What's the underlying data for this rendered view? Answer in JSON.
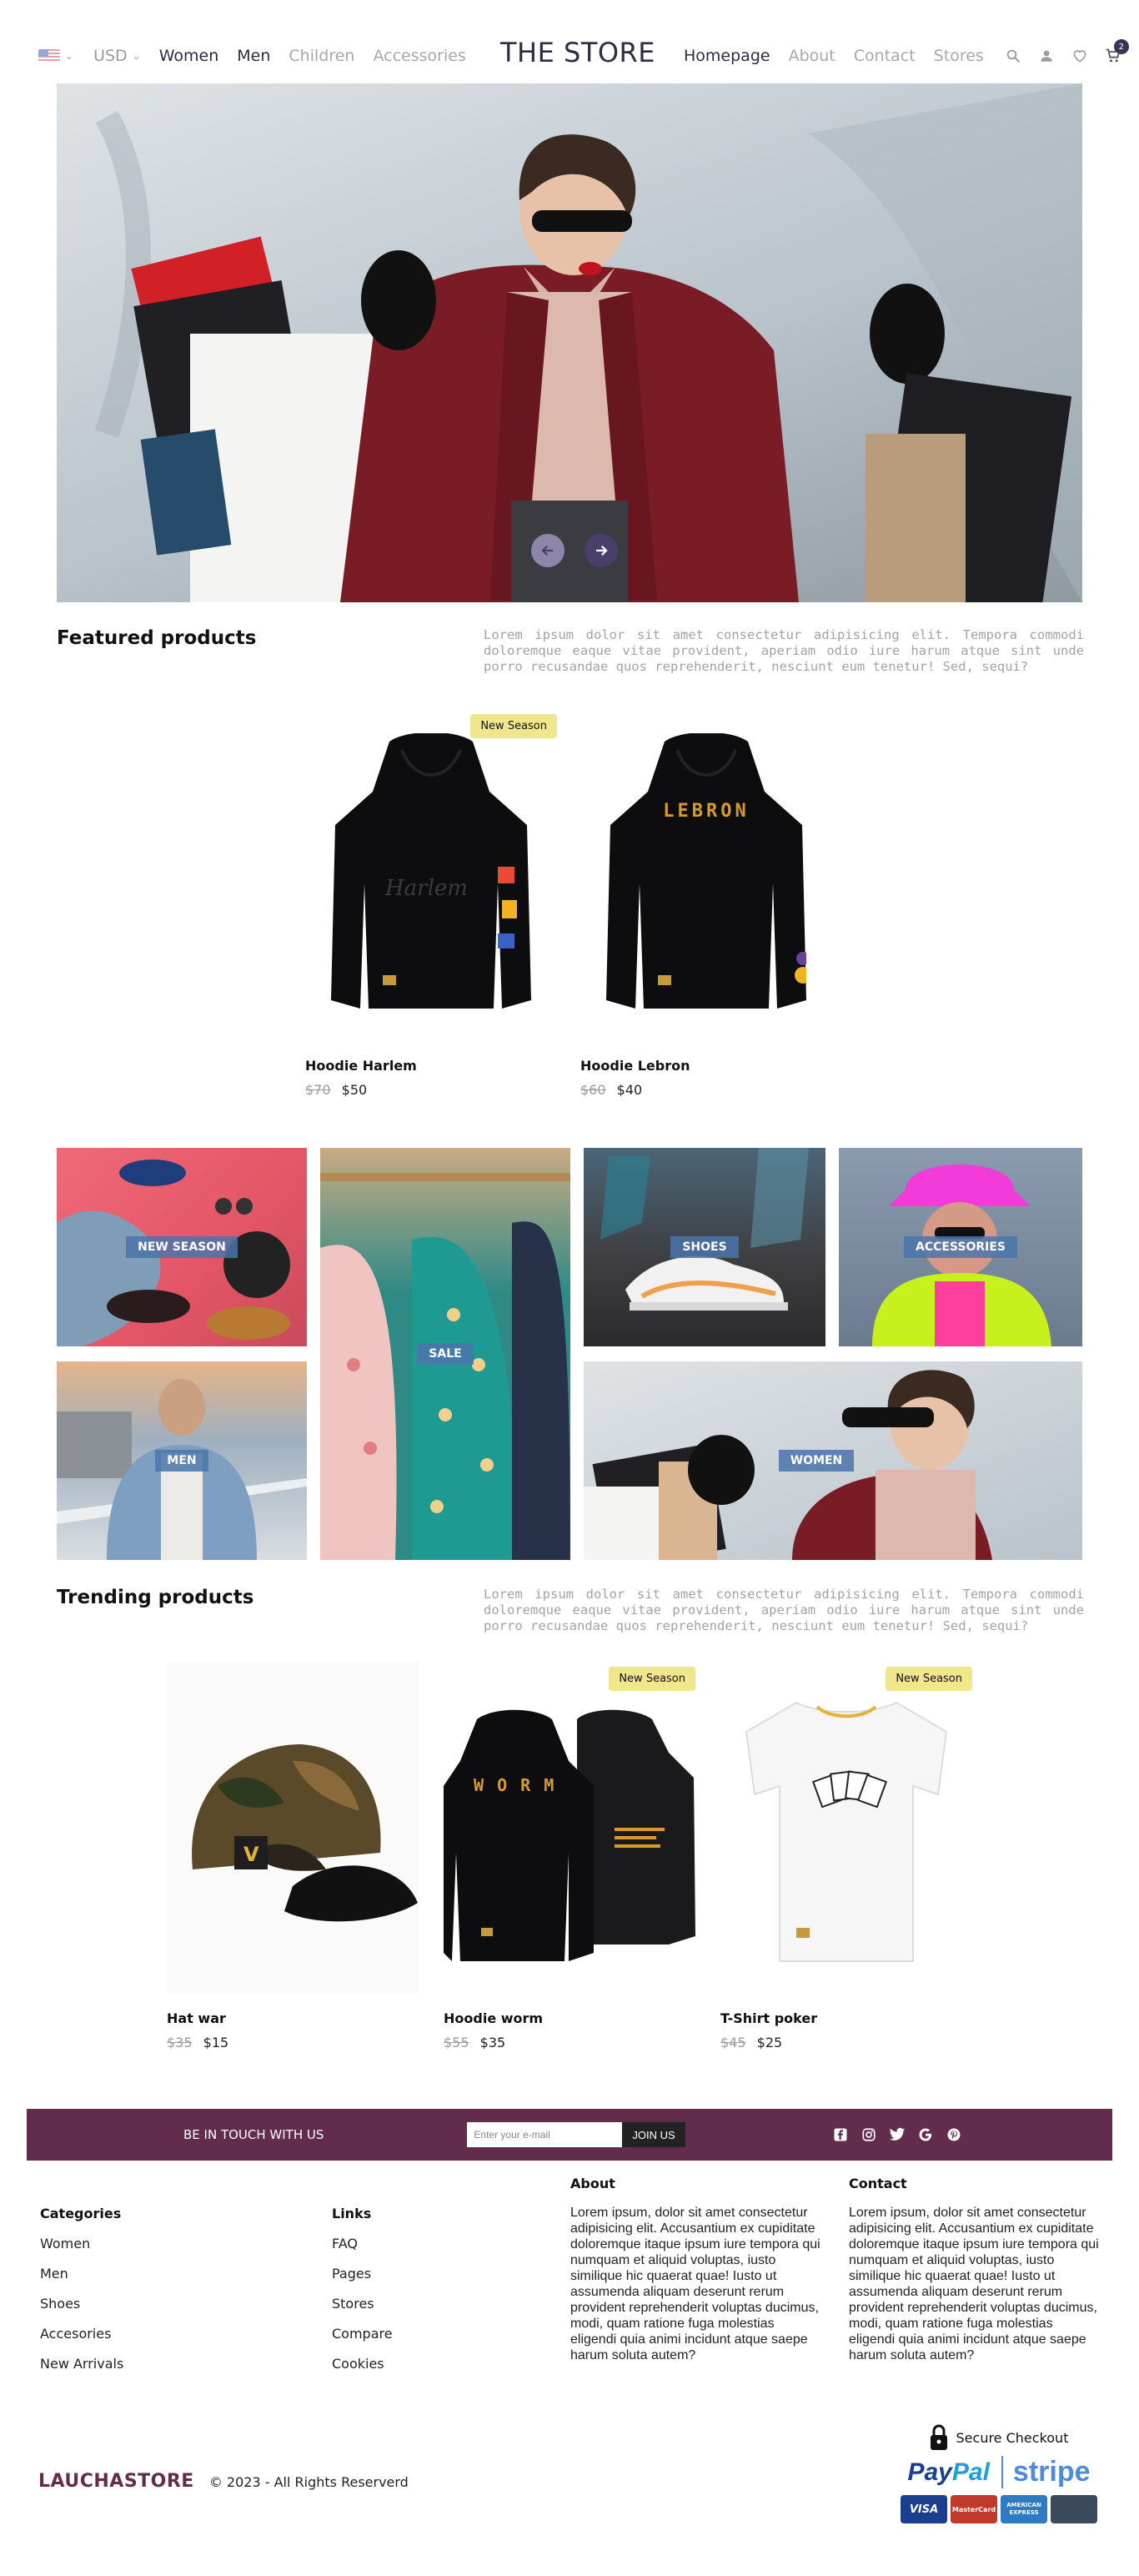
{
  "header": {
    "currency": "USD",
    "left_links": [
      "Women",
      "Men",
      "Children",
      "Accessories"
    ],
    "brand": "THE STORE",
    "right_links": [
      "Homepage",
      "About",
      "Contact",
      "Stores"
    ],
    "cart_count": "2"
  },
  "featured": {
    "title": "Featured products",
    "description": "Lorem ipsum dolor sit amet consectetur adipisicing elit. Tempora commodi doloremque eaque vitae provident, aperiam odio iure harum atque sint unde porro recusandae quos reprehenderit, nesciunt eum tenetur! Sed, sequi?",
    "products": [
      {
        "name": "Hoodie Harlem",
        "old_price": "$70",
        "price": "$50",
        "badge": "New Season",
        "print": "Harlem"
      },
      {
        "name": "Hoodie Lebron",
        "old_price": "$60",
        "price": "$40",
        "badge": "",
        "print": "LEBRON"
      }
    ]
  },
  "categories": {
    "new_season": "NEW SEASON",
    "sale": "SALE",
    "shoes": "SHOES",
    "accessories": "ACCESSORIES",
    "men": "MEN",
    "women": "WOMEN"
  },
  "trending": {
    "title": "Trending products",
    "description": "Lorem ipsum dolor sit amet consectetur adipisicing elit. Tempora commodi doloremque eaque vitae provident, aperiam odio iure harum atque sint unde porro recusandae quos reprehenderit, nesciunt eum tenetur! Sed, sequi?",
    "products": [
      {
        "name": "Hat war",
        "old_price": "$35",
        "price": "$15",
        "badge": ""
      },
      {
        "name": "Hoodie worm",
        "old_price": "$55",
        "price": "$35",
        "badge": "New Season",
        "print": "W O R M"
      },
      {
        "name": "T-Shirt poker",
        "old_price": "$45",
        "price": "$25",
        "badge": "New Season"
      }
    ]
  },
  "newsletter": {
    "title": "BE IN TOUCH WITH US",
    "placeholder": "Enter your e-mail",
    "button": "JOIN US"
  },
  "footer": {
    "categories_title": "Categories",
    "categories": [
      "Women",
      "Men",
      "Shoes",
      "Accesories",
      "New Arrivals"
    ],
    "links_title": "Links",
    "links": [
      "FAQ",
      "Pages",
      "Stores",
      "Compare",
      "Cookies"
    ],
    "about_title": "About",
    "about_text": "Lorem ipsum, dolor sit amet consectetur adipisicing elit. Accusantium ex cupiditate doloremque itaque ipsum iure tempora qui numquam et aliquid voluptas, iusto similique hic quaerat quae! Iusto ut assumenda aliquam deserunt rerum provident reprehenderit voluptas ducimus, modi, quam ratione fuga molestias eligendi quia animi incidunt atque saepe harum soluta autem?",
    "contact_title": "Contact",
    "contact_text": "Lorem ipsum, dolor sit amet consectetur adipisicing elit. Accusantium ex cupiditate doloremque itaque ipsum iure tempora qui numquam et aliquid voluptas, iusto similique hic quaerat quae! Iusto ut assumenda aliquam deserunt rerum provident reprehenderit voluptas ducimus, modi, quam ratione fuga molestias eligendi quia animi incidunt atque saepe harum soluta autem?",
    "brand": "LAUCHASTORE",
    "copyright": "© 2023 - All Rights Reserverd",
    "secure_checkout": "Secure Checkout",
    "paypal_a": "Pay",
    "paypal_b": "Pal",
    "stripe": "stripe",
    "cards": [
      "VISA",
      "MasterCard",
      "AMERICAN EXPRESS",
      ""
    ]
  },
  "colors": {
    "brand_purple": "#632c4d",
    "nav_dark": "#2c2c44",
    "badge_yellow": "#f0e68c",
    "category_label_blue": "#4a74aa"
  },
  "icons": [
    "chevron-down-icon",
    "search-icon",
    "user-icon",
    "heart-icon",
    "cart-icon",
    "arrow-left-icon",
    "arrow-right-icon",
    "facebook-icon",
    "instagram-icon",
    "twitter-icon",
    "google-icon",
    "pinterest-icon",
    "lock-icon"
  ]
}
